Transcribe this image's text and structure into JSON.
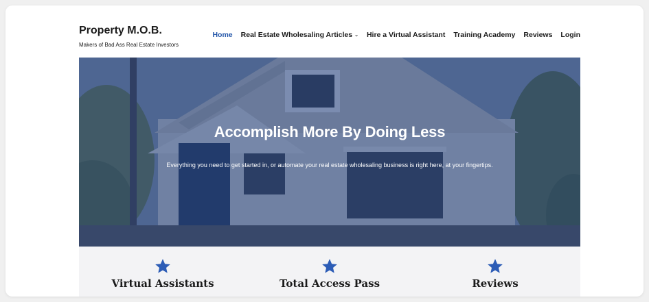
{
  "site": {
    "title": "Property M.O.B.",
    "tagline": "Makers of Bad Ass Real Estate Investors"
  },
  "nav": {
    "items": [
      {
        "label": "Home",
        "active": true
      },
      {
        "label": "Real Estate Wholesaling Articles",
        "has_dropdown": true
      },
      {
        "label": "Hire a Virtual Assistant"
      },
      {
        "label": "Training Academy"
      },
      {
        "label": "Reviews"
      },
      {
        "label": "Login"
      }
    ],
    "dropdown_icon": "chevron-down-icon"
  },
  "hero": {
    "title": "Accomplish More By Doing Less",
    "subtitle": "Everything you need to get started in, or automate your real estate wholesaling business is right here, at your fingertips.",
    "background": "old-house-photo"
  },
  "features": [
    {
      "icon": "star-icon",
      "label": "Virtual Assistants"
    },
    {
      "icon": "star-icon",
      "label": "Total Access Pass"
    },
    {
      "icon": "star-icon",
      "label": "Reviews"
    }
  ],
  "colors": {
    "accent": "#2255a8",
    "hero_overlay": "#1c3c80",
    "star": "#2c5cb6",
    "feature_bg": "#f3f3f5"
  }
}
